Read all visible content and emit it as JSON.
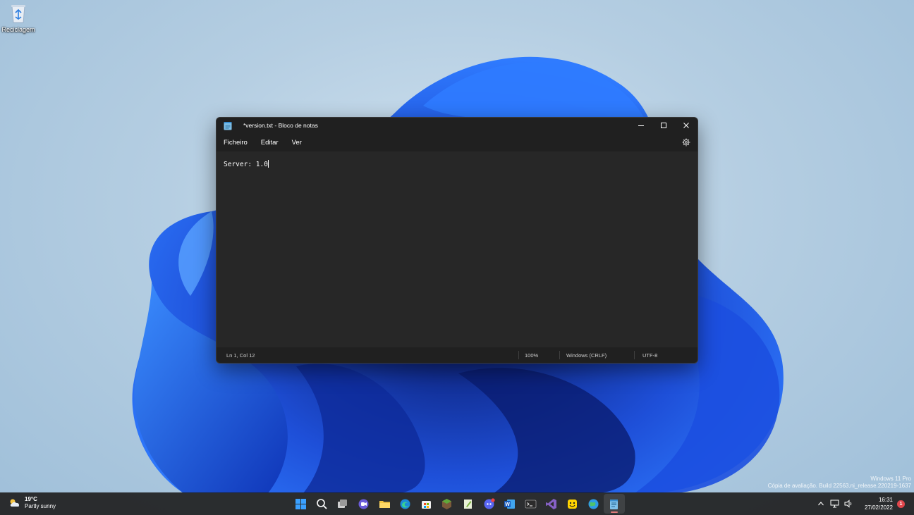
{
  "desktop": {
    "icons": [
      {
        "label": "Reciclagem",
        "icon": "recycle-bin-icon"
      }
    ]
  },
  "notepad": {
    "title": "*version.txt - Bloco de notas",
    "controls": {
      "minimize": "—",
      "maximize": "☐",
      "close": "✕"
    },
    "menu": [
      "Ficheiro",
      "Editar",
      "Ver"
    ],
    "content": "Server: 1.0",
    "status": {
      "position": "Ln 1, Col 12",
      "zoom": "100%",
      "line_ending": "Windows (CRLF)",
      "encoding": "UTF-8"
    }
  },
  "watermark": {
    "line1": "Windows 11 Pro",
    "line2": "Cópia de avaliação. Build 22563.ni_release.220219-1637"
  },
  "taskbar": {
    "weather": {
      "temp": "19°C",
      "condition": "Partly sunny"
    },
    "apps": [
      "start-button",
      "search",
      "task-view",
      "chat",
      "file-explorer",
      "edge",
      "microsoft-store",
      "minecraft",
      "notepad-plus-plus",
      "discord",
      "word",
      "terminal",
      "visual-studio",
      "tinder-like-app",
      "internet-explorer",
      "notepad"
    ],
    "clock": {
      "time": "16:31",
      "date": "27/02/2022"
    },
    "notifications": "1"
  },
  "colors": {
    "accent": "#0078d4",
    "window_bg": "#272727",
    "title_bg": "#202020",
    "taskbar_bg": "#202020"
  }
}
